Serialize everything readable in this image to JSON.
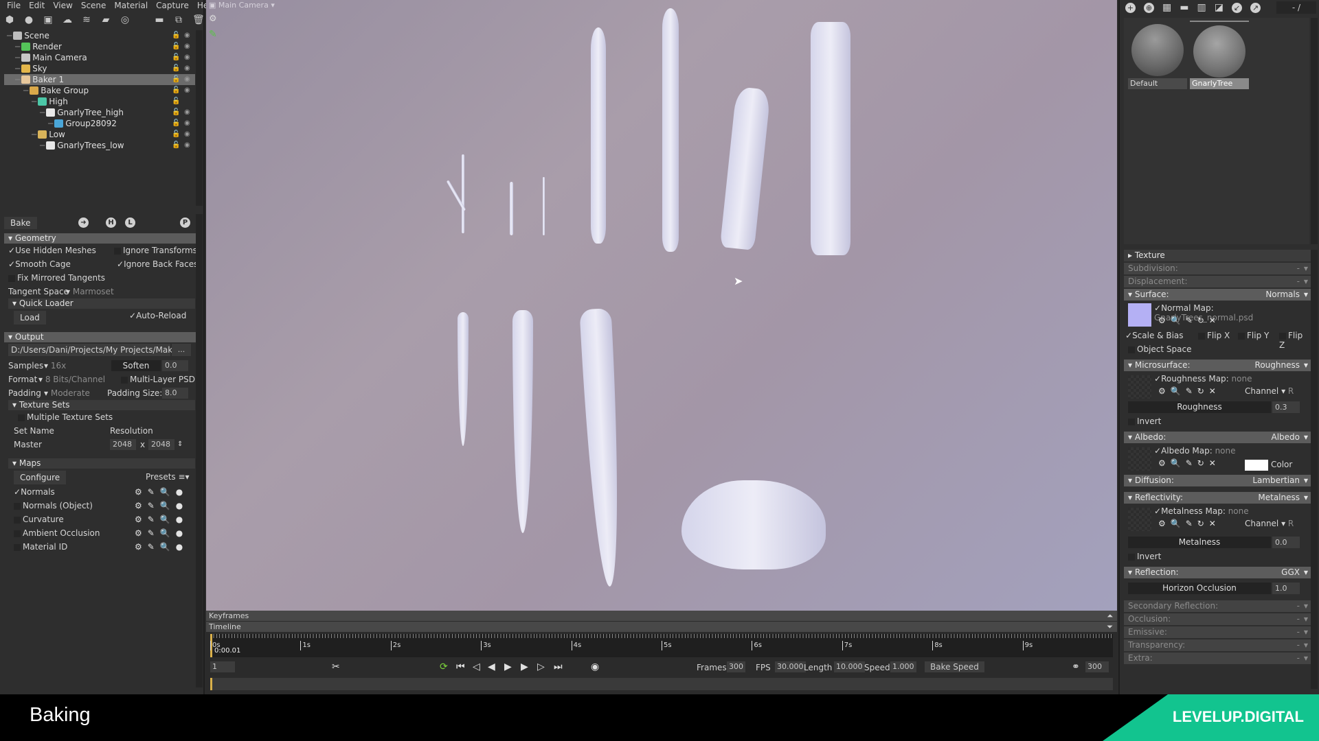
{
  "menu": [
    "File",
    "Edit",
    "View",
    "Scene",
    "Material",
    "Capture",
    "Help"
  ],
  "scene_toolbar_icons": [
    "mesh-icon",
    "light-icon",
    "camera-icon",
    "sky-icon",
    "fog-icon",
    "baker-icon",
    "render-icon",
    "folder-icon",
    "duplicate-icon",
    "trash-icon"
  ],
  "tree": [
    {
      "label": "Scene",
      "indent": 0,
      "icon": "scene-icon",
      "color": "#bdbdbd",
      "eye": true
    },
    {
      "label": "Render",
      "indent": 1,
      "icon": "render-icon",
      "color": "#55c45a",
      "eye": true
    },
    {
      "label": "Main Camera",
      "indent": 1,
      "icon": "camera-icon",
      "color": "#c7c7c7",
      "eye": true
    },
    {
      "label": "Sky",
      "indent": 1,
      "icon": "sky-icon",
      "color": "#e3b64b",
      "eye": true
    },
    {
      "label": "Baker 1",
      "indent": 1,
      "icon": "baker-icon",
      "color": "#e7c79b",
      "eye": true,
      "selected": true
    },
    {
      "label": "Bake Group",
      "indent": 2,
      "icon": "folder-icon",
      "color": "#d9a84a",
      "eye": true
    },
    {
      "label": "High",
      "indent": 3,
      "icon": "high-group-icon",
      "color": "#4cc7a7",
      "eye": false
    },
    {
      "label": "GnarlyTree_high",
      "indent": 4,
      "icon": "mesh-file-icon",
      "color": "#e8e8e8",
      "eye": true
    },
    {
      "label": "Group28092",
      "indent": 5,
      "icon": "cube-icon",
      "color": "#4aa6d8",
      "eye": true
    },
    {
      "label": "Low",
      "indent": 3,
      "icon": "low-group-icon",
      "color": "#d9b45a",
      "eye": true
    },
    {
      "label": "GnarlyTrees_low",
      "indent": 4,
      "icon": "mesh-file-icon",
      "color": "#e8e8e8",
      "eye": true
    }
  ],
  "bake": {
    "tab_label": "Bake",
    "icons": [
      "bake-arrow-icon",
      "H",
      "L",
      "P"
    ],
    "geometry": {
      "title": "Geometry",
      "use_hidden_meshes": {
        "label": "Use Hidden Meshes",
        "checked": true
      },
      "ignore_transforms": {
        "label": "Ignore Transforms",
        "checked": false
      },
      "smooth_cage": {
        "label": "Smooth Cage",
        "checked": true
      },
      "ignore_back_faces": {
        "label": "Ignore Back Faces",
        "checked": true
      },
      "fix_mirrored_tangents": {
        "label": "Fix Mirrored Tangents",
        "checked": false
      },
      "tangent_space_label": "Tangent Space",
      "tangent_space_value": "Marmoset",
      "quick_loader": "Quick Loader",
      "load_button": "Load",
      "auto_reload": {
        "label": "Auto-Reload",
        "checked": true
      }
    },
    "output": {
      "title": "Output",
      "path": "D:/Users/Dani/Projects/My Projects/Makin",
      "browse": "...",
      "samples_label": "Samples",
      "samples_value": "16x",
      "soften_label": "Soften",
      "soften_value": "0.0",
      "format_label": "Format",
      "format_value": "8 Bits/Channel",
      "multilayer_psd": {
        "label": "Multi-Layer PSD",
        "checked": false
      },
      "padding_label": "Padding",
      "padding_value": "Moderate",
      "padding_size_label": "Padding Size:",
      "padding_size_value": "8.0",
      "texture_sets": "Texture Sets",
      "multiple_texture_sets": {
        "label": "Multiple Texture Sets",
        "checked": false
      },
      "set_name_header": "Set Name",
      "resolution_header": "Resolution",
      "set_name": "Master",
      "res_w": "2048",
      "res_x": "x",
      "res_h": "2048"
    },
    "maps": {
      "title": "Maps",
      "configure": "Configure",
      "presets": "Presets",
      "items": [
        {
          "label": "Normals",
          "checked": true
        },
        {
          "label": "Normals (Object)",
          "checked": false
        },
        {
          "label": "Curvature",
          "checked": false
        },
        {
          "label": "Ambient Occlusion",
          "checked": false
        },
        {
          "label": "Material ID",
          "checked": false
        }
      ]
    }
  },
  "viewport": {
    "camera_label": "Main Camera"
  },
  "timeline": {
    "keyframes_label": "Keyframes",
    "timeline_label": "Timeline",
    "ticks": [
      "0s",
      "1s",
      "2s",
      "3s",
      "4s",
      "5s",
      "6s",
      "7s",
      "8s",
      "9s"
    ],
    "current_time": "0:00.01",
    "frame_field": "1",
    "frames_label": "Frames",
    "frames_value": "300",
    "fps_label": "FPS",
    "fps_value": "30.000",
    "length_label": "Length",
    "length_value": "10.000",
    "speed_label": "Speed",
    "speed_value": "1.000",
    "bake_speed": "Bake Speed",
    "end_frame": "300"
  },
  "materials": {
    "toolbar_icons": [
      "add-material-icon",
      "duplicate-material-icon",
      "checker-icon",
      "folder-icon",
      "trash-icon",
      "pick-icon",
      "import-icon",
      "export-icon"
    ],
    "page": "- /",
    "items": [
      {
        "label": "Default",
        "selected": false
      },
      {
        "label": "GnarlyTree",
        "selected": true
      }
    ]
  },
  "properties": {
    "texture": "Texture",
    "subdivision": {
      "label": "Subdivision:",
      "value": "-"
    },
    "displacement": {
      "label": "Displacement:",
      "value": "-"
    },
    "surface": {
      "label": "Surface:",
      "value": "Normals",
      "map_label": "Normal Map:",
      "map_value": "GnarlyTrees_normal.psd",
      "scale_bias": "Scale & Bias",
      "flip_x": "Flip X",
      "flip_y": "Flip Y",
      "flip_z": "Flip Z",
      "object_space": "Object Space",
      "swatch": "#b4b0f4"
    },
    "microsurface": {
      "label": "Microsurface:",
      "value": "Roughness",
      "map_label": "Roughness Map:",
      "map_value": "none",
      "channel_label": "Channel",
      "channel_value": "R",
      "slider_label": "Roughness",
      "slider_value": "0.3",
      "invert": "Invert"
    },
    "albedo": {
      "label": "Albedo:",
      "value": "Albedo",
      "map_label": "Albedo Map:",
      "map_value": "none",
      "color_label": "Color",
      "color": "#ffffff"
    },
    "diffusion": {
      "label": "Diffusion:",
      "value": "Lambertian"
    },
    "reflectivity": {
      "label": "Reflectivity:",
      "value": "Metalness",
      "map_label": "Metalness Map:",
      "map_value": "none",
      "channel_label": "Channel",
      "channel_value": "R",
      "slider_label": "Metalness",
      "slider_value": "0.0",
      "invert": "Invert"
    },
    "reflection": {
      "label": "Reflection:",
      "value": "GGX",
      "slider_label": "Horizon Occlusion",
      "slider_value": "1.0"
    },
    "collapsed": [
      {
        "label": "Secondary Reflection:",
        "value": "-"
      },
      {
        "label": "Occlusion:",
        "value": "-"
      },
      {
        "label": "Emissive:",
        "value": "-"
      },
      {
        "label": "Transparency:",
        "value": "-"
      },
      {
        "label": "Extra:",
        "value": "-"
      }
    ]
  },
  "footer": {
    "title": "Baking",
    "brand": "LEVELUP.DIGITAL",
    "brand_color": "#12c48f"
  }
}
